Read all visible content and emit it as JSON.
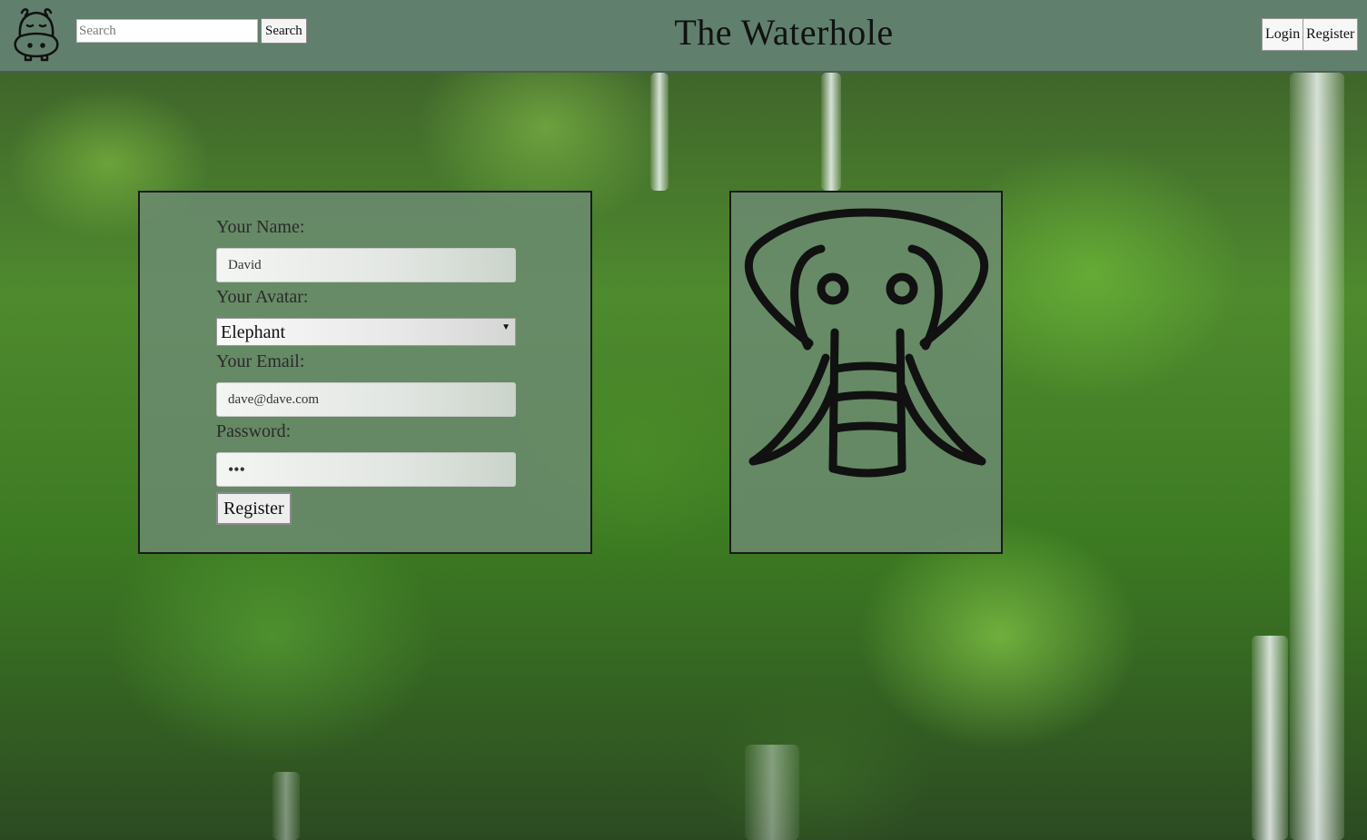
{
  "header": {
    "site_title": "The Waterhole",
    "logo_icon": "hippo-icon",
    "search_placeholder": "Search",
    "search_button_label": "Search",
    "login_label": "Login",
    "register_label": "Register"
  },
  "form": {
    "name_label": "Your Name:",
    "name_value": "David",
    "avatar_label": "Your Avatar:",
    "avatar_selected": "Elephant",
    "email_label": "Your Email:",
    "email_value": "dave@dave.com",
    "password_label": "Password:",
    "password_value": "•••",
    "submit_label": "Register"
  },
  "avatar_preview": {
    "icon": "elephant-icon"
  },
  "colors": {
    "header_bg": "#617f6d",
    "panel_bg": "#6e8c76"
  }
}
